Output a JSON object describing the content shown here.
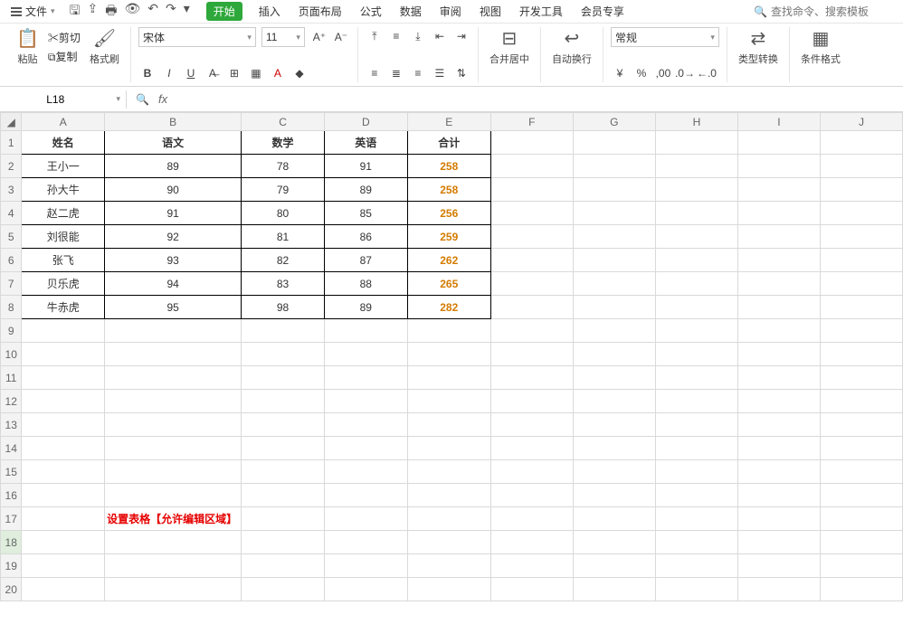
{
  "menu": {
    "file": "文件",
    "tabs": [
      "开始",
      "插入",
      "页面布局",
      "公式",
      "数据",
      "审阅",
      "视图",
      "开发工具",
      "会员专享"
    ],
    "search_placeholder": "查找命令、搜索模板"
  },
  "ribbon": {
    "paste": "粘贴",
    "cut": "剪切",
    "copy": "复制",
    "formatpainter": "格式刷",
    "font_name": "宋体",
    "font_size": "11",
    "merge": "合并居中",
    "wrap": "自动换行",
    "numfmt": "常规",
    "typeconv": "类型转换",
    "condfmt": "条件格式"
  },
  "namebox": "L18",
  "columns": [
    "A",
    "B",
    "C",
    "D",
    "E",
    "F",
    "G",
    "H",
    "I",
    "J"
  ],
  "row_count": 20,
  "selected": {
    "row": 18,
    "col": "L"
  },
  "table": {
    "headers": [
      "姓名",
      "语文",
      "数学",
      "英语",
      "合计"
    ],
    "rows": [
      {
        "name": "王小一",
        "chinese": 89,
        "math": 78,
        "english": 91,
        "total": 258
      },
      {
        "name": "孙大牛",
        "chinese": 90,
        "math": 79,
        "english": 89,
        "total": 258
      },
      {
        "name": "赵二虎",
        "chinese": 91,
        "math": 80,
        "english": 85,
        "total": 256
      },
      {
        "name": "刘很能",
        "chinese": 92,
        "math": 81,
        "english": 86,
        "total": 259
      },
      {
        "name": "张飞",
        "chinese": 93,
        "math": 82,
        "english": 87,
        "total": 262
      },
      {
        "name": "贝乐虎",
        "chinese": 94,
        "math": 83,
        "english": 88,
        "total": 265
      },
      {
        "name": "牛赤虎",
        "chinese": 95,
        "math": 98,
        "english": 89,
        "total": 282
      }
    ]
  },
  "annotation": "设置表格【允许编辑区域】",
  "chart_data": {
    "type": "table",
    "title": "",
    "columns": [
      "姓名",
      "语文",
      "数学",
      "英语",
      "合计"
    ],
    "rows": [
      [
        "王小一",
        89,
        78,
        91,
        258
      ],
      [
        "孙大牛",
        90,
        79,
        89,
        258
      ],
      [
        "赵二虎",
        91,
        80,
        85,
        256
      ],
      [
        "刘很能",
        92,
        81,
        86,
        259
      ],
      [
        "张飞",
        93,
        82,
        87,
        262
      ],
      [
        "贝乐虎",
        94,
        83,
        88,
        265
      ],
      [
        "牛赤虎",
        95,
        98,
        89,
        282
      ]
    ]
  }
}
